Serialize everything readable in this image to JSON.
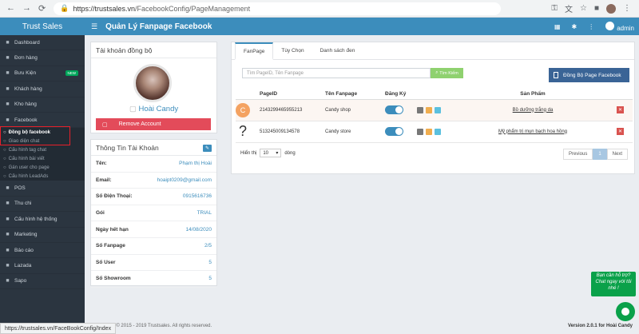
{
  "browser": {
    "url_proto": "https://",
    "url_host": "trustsales.vn",
    "url_path": "/FacebookConfig/PageManagement",
    "status_url": "https://trustsales.vn/FaceBookConfig/Index"
  },
  "sidebar": {
    "brand": "Trust Sales",
    "items_top": [
      {
        "label": "Dashboard",
        "icon": "dashboard-icon"
      },
      {
        "label": "Đơn hàng",
        "icon": "cart-icon"
      },
      {
        "label": "Bưu Kiện",
        "icon": "package-icon",
        "badge": "NEW"
      },
      {
        "label": "Khách hàng",
        "icon": "users-icon"
      },
      {
        "label": "Kho hàng",
        "icon": "warehouse-icon"
      },
      {
        "label": "Facebook",
        "icon": "facebook-icon"
      }
    ],
    "submenu": [
      {
        "label": "Đồng bộ facebook",
        "active": true
      },
      {
        "label": "Giao diện chat"
      },
      {
        "label": "Cấu hình tag chat"
      },
      {
        "label": "Cấu hình bài viết"
      },
      {
        "label": "Gán user cho page"
      },
      {
        "label": "Cấu hình LeadAds"
      }
    ],
    "items_bottom": [
      {
        "label": "POS",
        "icon": "pos-icon"
      },
      {
        "label": "Thu chi",
        "icon": "money-icon"
      },
      {
        "label": "Cấu hình hệ thống",
        "icon": "gear-icon"
      },
      {
        "label": "Marketing",
        "icon": "megaphone-icon"
      },
      {
        "label": "Báo cáo",
        "icon": "chart-icon"
      },
      {
        "label": "Lazada",
        "icon": "store-icon"
      },
      {
        "label": "Sapo",
        "icon": "store-icon"
      }
    ]
  },
  "topbar": {
    "title": "Quản Lý Fanpage Facebook",
    "user": "admin"
  },
  "sync_account": {
    "title": "Tài khoản đồng bộ",
    "name": "Hoài Candy",
    "remove_label": "Remove Account"
  },
  "account_info": {
    "title": "Thông Tin Tài Khoản",
    "rows": [
      {
        "k": "Tên:",
        "v": "Phạm thị Hoài"
      },
      {
        "k": "Email:",
        "v": "hoaipt0209@gmail.com"
      },
      {
        "k": "Số Điện Thoại:",
        "v": "0915616736"
      },
      {
        "k": "Gói",
        "v": "TRIAL"
      },
      {
        "k": "Ngày hết hạn",
        "v": "14/08/2020"
      },
      {
        "k": "Số Fanpage",
        "v": "2/5"
      },
      {
        "k": "Số User",
        "v": "5"
      },
      {
        "k": "Số Showroom",
        "v": "5"
      }
    ]
  },
  "main": {
    "tabs": [
      "FanPage",
      "Tùy Chọn",
      "Danh sách đen"
    ],
    "search_placeholder": "Tìm PageID, Tên Fanpage",
    "search_button": "Tìm Kiếm",
    "sync_button": "Đồng Bộ Page Facebook",
    "columns": [
      "PageID",
      "Tên Fanpage",
      "Đăng Ký",
      "Sản Phẩm"
    ],
    "rows": [
      {
        "avatar": "C",
        "page_id": "2143299465955213",
        "name": "Candy shop",
        "product": "Bồ dưỡng trắng da"
      },
      {
        "avatar": "?",
        "page_id": "513245009134578",
        "name": "Candy store",
        "product": "Mỹ phẩm trị mụn bạch hoa hồng"
      }
    ],
    "show_label": "Hiển thị",
    "page_size": "10",
    "rows_label": "dòng",
    "prev": "Previous",
    "page": "1",
    "next": "Next"
  },
  "footer": {
    "copyright": "Copyright © 2015 - 2019 Trustsales. All rights reserved.",
    "version": "Version 2.0.1 for Hoài Candy"
  },
  "chat": {
    "bubble": "Bạn cần hỗ trợ? Chat ngay với tôi nhé !"
  }
}
